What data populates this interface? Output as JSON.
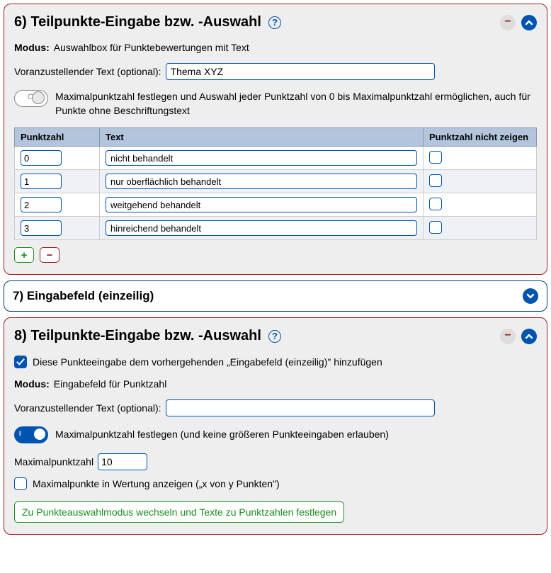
{
  "panel6": {
    "title": "6) Teilpunkte-Eingabe bzw. -Auswahl",
    "modus_label": "Modus:",
    "modus_value": "Auswahlbox für Punktebewertungen mit Text",
    "prefix_label": "Voranzustellender Text (optional):",
    "prefix_value": "Thema XYZ",
    "max_toggle_on": false,
    "max_toggle_label": "Maximalpunktzahl festlegen und Auswahl jeder Punktzahl von 0 bis Maximalpunktzahl ermöglichen, auch für Punkte ohne Beschriftungstext",
    "table": {
      "headers": {
        "points": "Punktzahl",
        "text": "Text",
        "hide": "Punktzahl nicht zeigen"
      },
      "rows": [
        {
          "points": "0",
          "text": "nicht behandelt",
          "hide": false
        },
        {
          "points": "1",
          "text": "nur oberflächlich behandelt",
          "hide": false
        },
        {
          "points": "2",
          "text": "weitgehend behandelt",
          "hide": false
        },
        {
          "points": "3",
          "text": "hinreichend behandelt",
          "hide": false
        }
      ]
    }
  },
  "panel7": {
    "title": "7) Eingabefeld (einzeilig)"
  },
  "panel8": {
    "title": "8) Teilpunkte-Eingabe bzw. -Auswahl",
    "attach_checked": true,
    "attach_label": "Diese Punkteeingabe dem vorhergehenden „Eingabefeld (einzeilig)\" hinzufügen",
    "modus_label": "Modus:",
    "modus_value": "Eingabefeld für Punktzahl",
    "prefix_label": "Voranzustellender Text (optional):",
    "prefix_value": "",
    "max_toggle_on": true,
    "max_toggle_label": "Maximalpunktzahl festlegen (und keine größeren Punkteeingaben erlauben)",
    "maxpts_label": "Maximalpunktzahl",
    "maxpts_value": "10",
    "show_max_checked": false,
    "show_max_label": "Maximalpunkte in Wertung anzeigen („x von y Punkten\")",
    "switch_mode_btn": "Zu Punkteauswahlmodus wechseln und Texte zu Punktzahlen festlegen"
  },
  "icons": {
    "help": "?",
    "minus": "−",
    "plus": "+"
  }
}
